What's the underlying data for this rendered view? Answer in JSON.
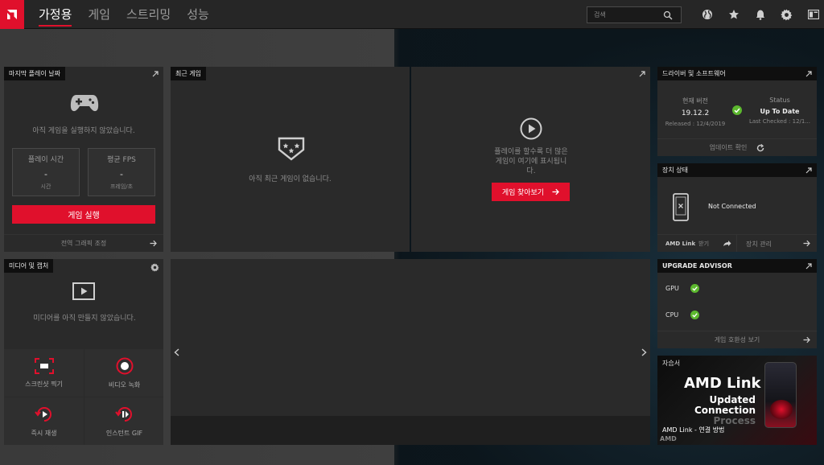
{
  "nav": {
    "tabs": [
      {
        "label": "가정용"
      },
      {
        "label": "게임"
      },
      {
        "label": "스트리밍"
      },
      {
        "label": "성능"
      }
    ],
    "search_placeholder": "검색"
  },
  "colors": {
    "accent": "#e0102c",
    "ok": "#5cb82e",
    "panel": "#2a2a2a"
  },
  "last_played": {
    "title": "마지막 플레이 날짜",
    "empty_text": "아직 게임을 실행하지 않았습니다.",
    "play_time_label": "플레이 시간",
    "play_time_value": "-",
    "play_time_unit": "시간",
    "fps_label": "평균 FPS",
    "fps_value": "-",
    "fps_unit": "프레임/초",
    "launch_button": "게임 실행",
    "footer": "전역 그래픽 조정"
  },
  "recent_games": {
    "title": "최근 게임",
    "empty_text": "아직 최근 게임이 없습니다.",
    "hint_text": "플레이를 할수록 더 많은 게임이 여기에 표시됩니다.",
    "find_button": "게임 찾아보기"
  },
  "media": {
    "title": "미디어 및 캡처",
    "empty_text": "미디어를 아직 만들지 않았습니다.",
    "screenshot": "스크린샷 찍기",
    "record": "비디오 녹화",
    "instant_replay": "즉시 재생",
    "instant_gif": "인스턴트 GIF"
  },
  "driver": {
    "title": "드라이버 및 소프트웨어",
    "current_label": "현재 버전",
    "current_value": "19.12.2",
    "released": "Released : 12/4/2019",
    "status_label": "Status",
    "status_value": "Up To Date",
    "last_checked": "Last Checked : 12/1...",
    "footer": "업데이트 확인"
  },
  "device": {
    "title": "장치 상태",
    "status": "Not Connected",
    "get_link_brand": "AMD Link",
    "get_link_rest": "받기",
    "manage": "장치 관리"
  },
  "upgrade": {
    "title": "UPGRADE ADVISOR",
    "items": [
      {
        "label": "GPU"
      },
      {
        "label": "CPU"
      }
    ],
    "footer": "게임 호환성 보기"
  },
  "tutorial": {
    "title": "자습서",
    "headline": "AMD Link",
    "sub1": "Updated",
    "sub2": "Connection",
    "sub3": "Process",
    "caption": "AMD Link - 연결 방법",
    "brand": "AMD"
  },
  "icons": [
    "amd-logo-icon",
    "globe-icon",
    "star-icon",
    "bell-icon",
    "gear-icon",
    "layout-icon",
    "search-icon",
    "expand-icon",
    "gamepad-icon",
    "shield-stars-icon",
    "play-icon",
    "arrow-right-icon",
    "check-icon",
    "refresh-icon",
    "phone-icon",
    "share-icon",
    "chevron-left-icon",
    "chevron-right-icon",
    "screenshot-icon",
    "record-icon",
    "replay-icon",
    "gif-icon"
  ]
}
